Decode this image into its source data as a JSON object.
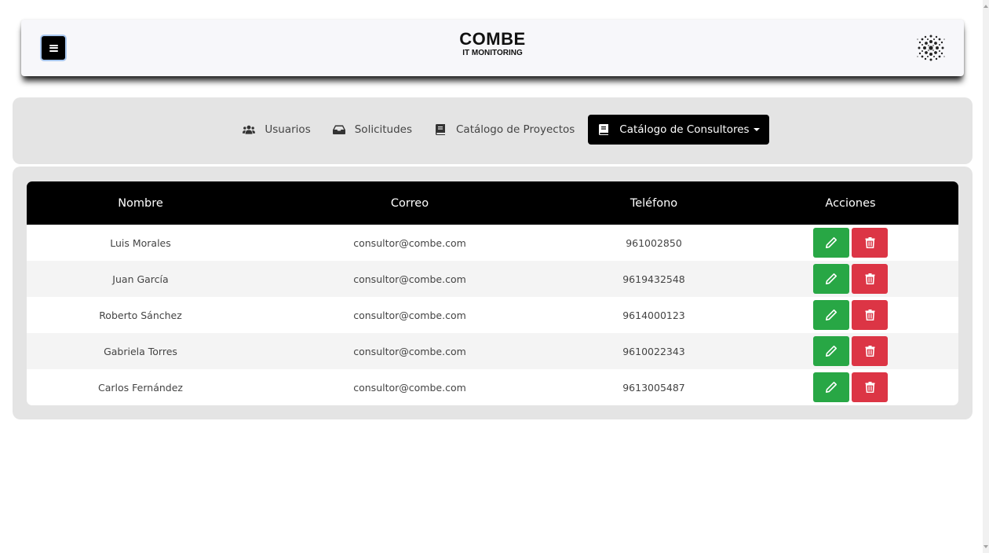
{
  "header": {
    "brand_title": "COMBE",
    "brand_subtitle": "IT MONITORING",
    "menu_icon": "hamburger-icon",
    "logo_icon": "dots-burst-logo"
  },
  "nav": {
    "items": [
      {
        "label": "Usuarios",
        "icon": "users-icon",
        "active": false
      },
      {
        "label": "Solicitudes",
        "icon": "inbox-icon",
        "active": false
      },
      {
        "label": "Catálogo de Proyectos",
        "icon": "book-icon",
        "active": false
      },
      {
        "label": "Catálogo de Consultores",
        "icon": "book-icon",
        "active": true
      }
    ]
  },
  "table": {
    "headers": [
      "Nombre",
      "Correo",
      "Teléfono",
      "Acciones"
    ],
    "rows": [
      {
        "nombre": "Luis Morales",
        "correo": "consultor@combe.com",
        "telefono": "961002850"
      },
      {
        "nombre": "Juan García",
        "correo": "consultor@combe.com",
        "telefono": "9619432548"
      },
      {
        "nombre": "Roberto Sánchez",
        "correo": "consultor@combe.com",
        "telefono": "9614000123"
      },
      {
        "nombre": "Gabriela Torres",
        "correo": "consultor@combe.com",
        "telefono": "9610022343"
      },
      {
        "nombre": "Carlos Fernández",
        "correo": "consultor@combe.com",
        "telefono": "9613005487"
      }
    ]
  },
  "colors": {
    "edit": "#28a745",
    "delete": "#dc3545",
    "active_nav": "#000000",
    "panel_bg": "#e4e4e4"
  }
}
